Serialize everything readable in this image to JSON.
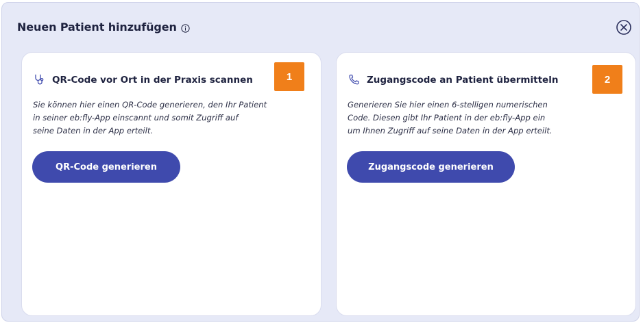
{
  "dialog": {
    "title": "Neuen Patient hinzufügen",
    "info_icon": "info-circle-icon",
    "close_icon": "close-circle-icon"
  },
  "cards": [
    {
      "icon": "stethoscope-icon",
      "title": "QR-Code vor Ort in der Praxis scannen",
      "description_lines": [
        "Sie können hier einen QR-Code generieren, den Ihr Patient",
        "in seiner eb:fly-App einscannt und somit Zugriff auf",
        "seine Daten in der App erteilt."
      ],
      "button_label": "QR-Code generieren",
      "badge": "1"
    },
    {
      "icon": "phone-icon",
      "title": "Zugangscode an Patient übermitteln",
      "description_lines": [
        "Generieren Sie hier einen 6-stelligen numerischen",
        "Code. Diesen gibt Ihr Patient in der eb:fly-App ein",
        "um Ihnen Zugriff auf seine Daten in der App erteilt."
      ],
      "button_label": "Zugangscode generieren",
      "badge": "2"
    }
  ],
  "colors": {
    "dialog_background": "#e6e9f7",
    "primary_button": "#3f4aad",
    "badge": "#f07f1a",
    "text_dark": "#1f2340"
  }
}
